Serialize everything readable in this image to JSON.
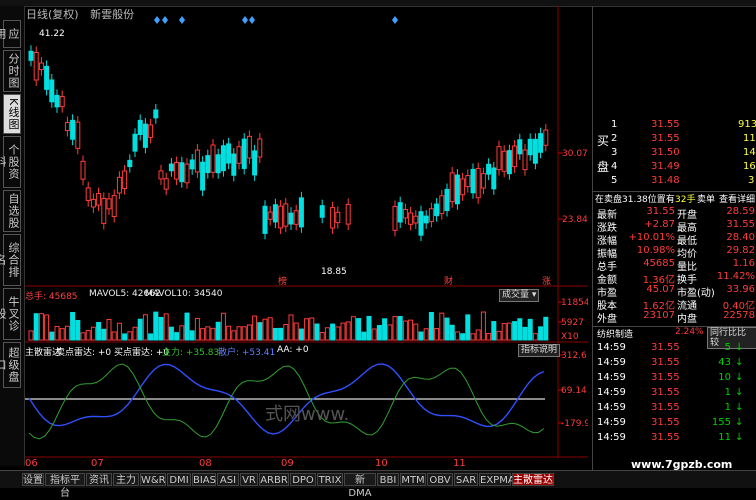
{
  "titlebar": {
    "mode": "日线(复权)",
    "indicator_name": "新雲般份"
  },
  "left_tabs": [
    "应用",
    "分时图",
    "K线图",
    "个股资料",
    "自选股",
    "综合排名",
    "牛叉诊股",
    "超级盘口"
  ],
  "price_pane": {
    "high_label": "41.22",
    "low_label": "18.85",
    "axis_labels": [
      "30.07",
      "23.84"
    ],
    "markers": [
      "榜",
      "财",
      "涨"
    ]
  },
  "volume_pane": {
    "zongshou_label": "总手: 45685",
    "mavol5_label": "MAVOL5: 42662",
    "mavol10_label": "MAVOL10: 34540",
    "dropdown_label": "成交量",
    "axis_labels": [
      "11854",
      "5927"
    ],
    "axis_unit": "X10"
  },
  "indicator_pane": {
    "name": "主散雷达",
    "buy_sell_label": "卖点雷达: +0",
    "buy_label": "买点雷达: +0",
    "main_label": "主力: +35.83",
    "retail_label": "散户: +53.41",
    "aa_label": "AA: +0",
    "explain_button": "指标说明",
    "axis_labels": [
      "312.6",
      "69.14",
      "-179.9"
    ]
  },
  "time_axis": [
    "06",
    "07",
    "08",
    "09",
    "10",
    "11"
  ],
  "bottom_tabs": [
    "设置",
    "指标平台",
    "资讯",
    "主力",
    "W&R",
    "DMI",
    "BIAS",
    "ASI",
    "VR",
    "ARBR",
    "DPO",
    "TRIX",
    "新DMA",
    "BBI",
    "MTM",
    "OBV",
    "SAR",
    "EXPMA",
    "主散雷达"
  ],
  "right_panel": {
    "sell_label": "卖",
    "buy_label": "买",
    "pan_label": "盘",
    "book": [
      {
        "lvl": "1",
        "price": "31.55",
        "vol": "913"
      },
      {
        "lvl": "2",
        "price": "31.55",
        "vol": "11"
      },
      {
        "lvl": "3",
        "price": "31.50",
        "vol": "14"
      },
      {
        "lvl": "4",
        "price": "31.49",
        "vol": "16"
      },
      {
        "lvl": "5",
        "price": "31.48",
        "vol": "3"
      }
    ],
    "tail_info": "在卖盘31.38位置有",
    "tail_vol": "32手",
    "sell_single": "卖单",
    "view_detail": "查看详细",
    "stats": [
      {
        "k1": "最新",
        "v1": "31.55",
        "k2": "开盘",
        "v2": "28.59"
      },
      {
        "k1": "涨跌",
        "v1": "+2.87",
        "k2": "最高",
        "v2": "31.55"
      },
      {
        "k1": "涨幅",
        "v1": "+10.01%",
        "k2": "最低",
        "v2": "28.40"
      },
      {
        "k1": "振幅",
        "v1": "10.98%",
        "k2": "均价",
        "v2": "29.82"
      },
      {
        "k1": "总手",
        "v1": "45685",
        "k2": "量比",
        "v2": "1.16"
      },
      {
        "k1": "金额",
        "v1": "1.36亿",
        "k2": "换手",
        "v2": "11.42%"
      },
      {
        "k1": "市盈",
        "v1": "45.07",
        "k2": "市盈(动)",
        "v2": "33.96"
      },
      {
        "k1": "股本",
        "v1": "1.62亿",
        "k2": "流通",
        "v2": "0.40亿"
      },
      {
        "k1": "外盘",
        "v1": "23107",
        "k2": "内盘",
        "v2": "22578"
      }
    ],
    "industry": "纺织制造",
    "industry_pct": "2.24%",
    "compare_button": "同行比比较",
    "ticks": [
      {
        "t": "14:59",
        "p": "31.55",
        "v": "5"
      },
      {
        "t": "14:59",
        "p": "31.55",
        "v": "43"
      },
      {
        "t": "14:59",
        "p": "31.55",
        "v": "10"
      },
      {
        "t": "14:59",
        "p": "31.55",
        "v": "1"
      },
      {
        "t": "14:59",
        "p": "31.55",
        "v": "1"
      },
      {
        "t": "14:59",
        "p": "31.55",
        "v": "155"
      },
      {
        "t": "14:59",
        "p": "31.55",
        "v": "11"
      }
    ],
    "watermark": "www.7gpzb.com"
  },
  "center_watermark": "式网www."
}
